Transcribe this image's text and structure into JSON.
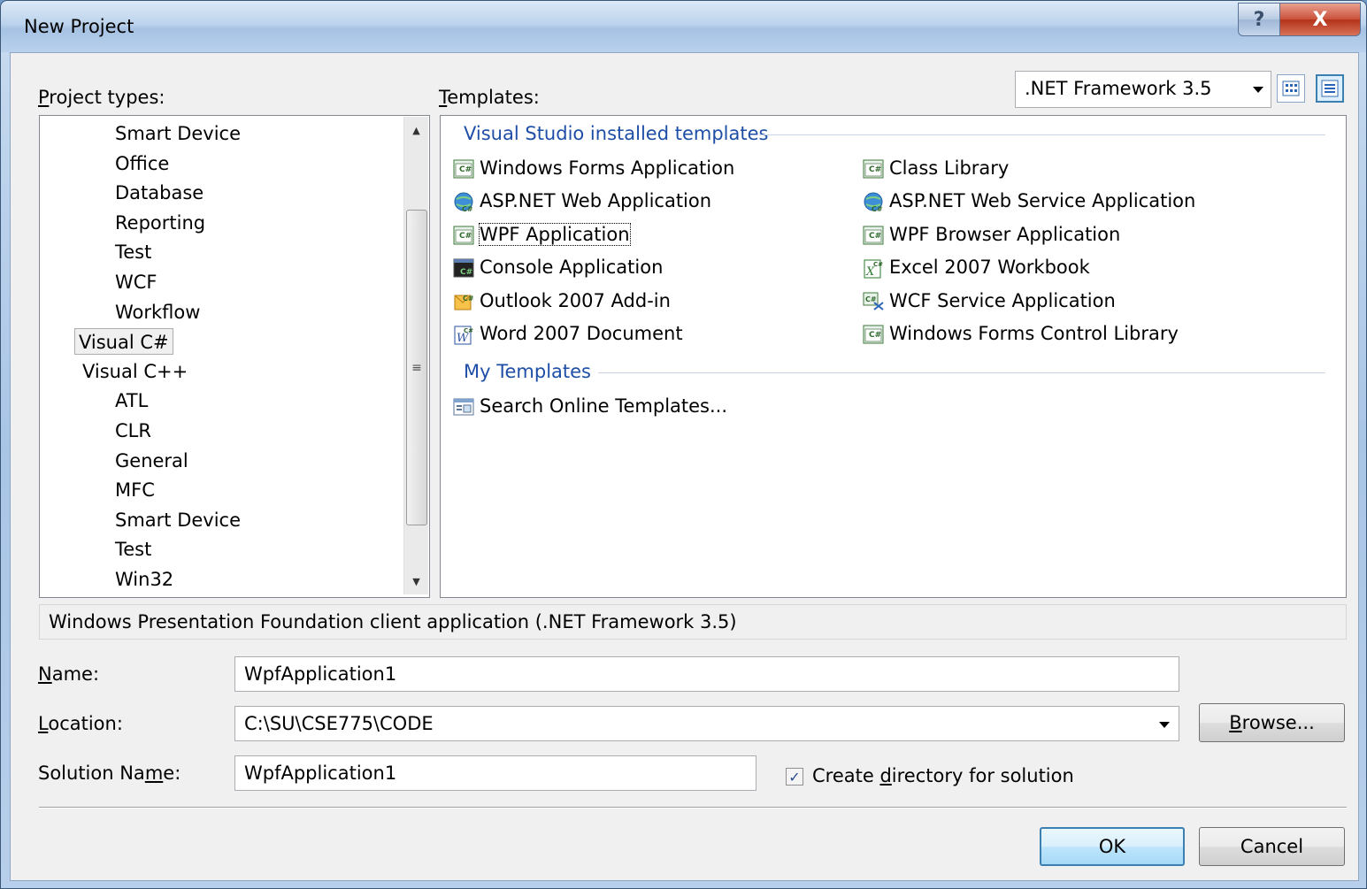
{
  "window": {
    "title": "New Project",
    "help_label": "?",
    "close_label": "X"
  },
  "labels": {
    "project_types": "Project types:",
    "templates": "Templates:"
  },
  "framework": {
    "selected": ".NET Framework 3.5"
  },
  "project_types": [
    {
      "label": "Smart Device",
      "level": 2
    },
    {
      "label": "Office",
      "level": 2
    },
    {
      "label": "Database",
      "level": 2
    },
    {
      "label": "Reporting",
      "level": 2
    },
    {
      "label": "Test",
      "level": 2
    },
    {
      "label": "WCF",
      "level": 2
    },
    {
      "label": "Workflow",
      "level": 2
    },
    {
      "label": "Visual C#",
      "level": 1,
      "selected": true
    },
    {
      "label": "Visual C++",
      "level": 1
    },
    {
      "label": "ATL",
      "level": 2
    },
    {
      "label": "CLR",
      "level": 2
    },
    {
      "label": "General",
      "level": 2
    },
    {
      "label": "MFC",
      "level": 2
    },
    {
      "label": "Smart Device",
      "level": 2
    },
    {
      "label": "Test",
      "level": 2
    },
    {
      "label": "Win32",
      "level": 2
    }
  ],
  "templates": {
    "installed_header": "Visual Studio installed templates",
    "installed_left": [
      "Windows Forms Application",
      "ASP.NET Web Application",
      "WPF Application",
      "Console Application",
      "Outlook 2007 Add-in",
      "Word 2007 Document"
    ],
    "installed_right": [
      "Class Library",
      "ASP.NET Web Service Application",
      "WPF Browser Application",
      "Excel 2007 Workbook",
      "WCF Service Application",
      "Windows Forms Control Library"
    ],
    "my_header": "My Templates",
    "my_items": [
      "Search Online Templates..."
    ],
    "selected": "WPF Application"
  },
  "description": "Windows Presentation Foundation client application (.NET Framework 3.5)",
  "form": {
    "name_label": "Name:",
    "name_value": "WpfApplication1",
    "location_label": "Location:",
    "location_value": "C:\\SU\\CSE775\\CODE",
    "solution_label": "Solution Name:",
    "solution_value": "WpfApplication1",
    "create_dir_label": "Create directory for solution",
    "create_dir_checked": true
  },
  "buttons": {
    "browse": "Browse...",
    "ok": "OK",
    "cancel": "Cancel"
  }
}
